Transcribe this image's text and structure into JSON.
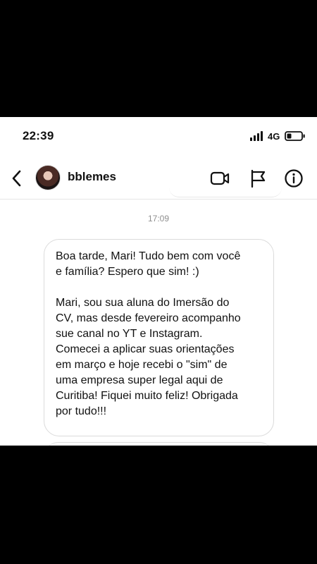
{
  "status_bar": {
    "time": "22:39",
    "network": "4G",
    "icons": {
      "signal": "signal-icon",
      "battery": "battery-icon"
    }
  },
  "chat_header": {
    "username": "bblemes",
    "icons": {
      "back": "chevron-left-icon",
      "video": "video-call-icon",
      "flag": "flag-icon",
      "info": "info-icon"
    }
  },
  "conversation": {
    "timestamp": "17:09",
    "message": {
      "paragraph_1": "Boa tarde, Mari! Tudo bem com você\ne família? Espero que sim! :)",
      "paragraph_2": "Mari, sou sua aluna do Imersão do\nCV, mas desde fevereiro acompanho\nsue canal no YT e Instagram.\nComecei a aplicar suas orientações\nem março e hoje recebi o \"sim\" de\numa empresa super legal aqui de\nCuritiba! Fiquei muito feliz! Obrigada\npor tudo!!!"
    }
  },
  "colors": {
    "background": "#000000",
    "screen": "#ffffff",
    "text": "#111111",
    "muted": "#8e8e8e",
    "border": "#dbdbdb"
  }
}
